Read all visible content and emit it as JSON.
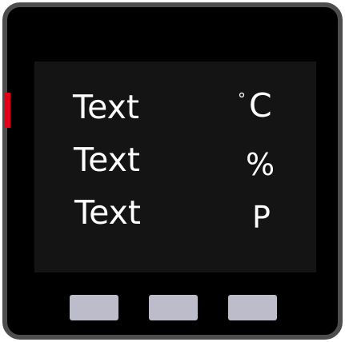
{
  "device": {
    "frame_color": "#4d4d4d",
    "indicator_color": "#e0001a",
    "screen_color": "#141414",
    "button_color": "#bdbccb"
  },
  "screen": {
    "rows": [
      {
        "label": "Text",
        "unit_symbol": "°",
        "unit": "C"
      },
      {
        "label": "Text",
        "unit": "%"
      },
      {
        "label": "Text",
        "unit": "P"
      }
    ]
  },
  "buttons": [
    {
      "name": "left"
    },
    {
      "name": "middle"
    },
    {
      "name": "right"
    }
  ]
}
